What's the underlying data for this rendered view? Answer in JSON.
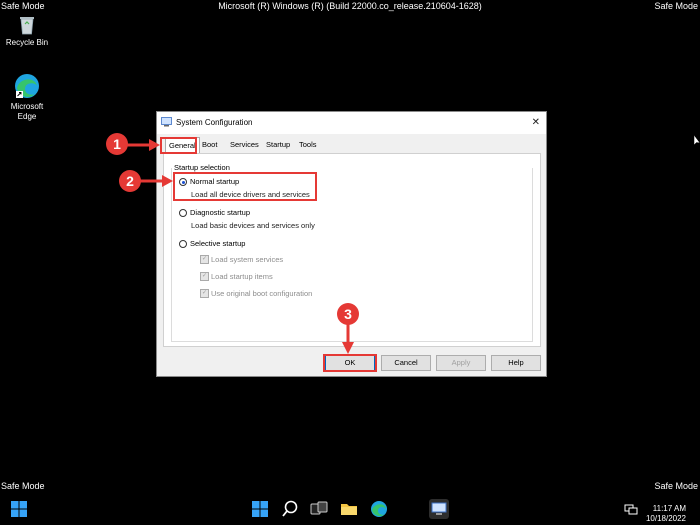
{
  "screen": {
    "top_left": "Safe Mode",
    "top_right": "Safe Mode",
    "bottom_left": "Safe Mode",
    "bottom_right": "Safe Mode",
    "top_center": "Microsoft (R) Windows (R) (Build 22000.co_release.210604-1628)"
  },
  "desktop": {
    "icons": [
      {
        "label": "Recycle Bin",
        "icon": "recycle-bin-icon"
      },
      {
        "label_line1": "Microsoft",
        "label_line2": "Edge",
        "icon": "edge-icon"
      }
    ]
  },
  "dialog": {
    "title": "System Configuration",
    "close_glyph": "✕",
    "tabs": [
      "General",
      "Boot",
      "Services",
      "Startup",
      "Tools"
    ],
    "active_tab": "General",
    "group_title": "Startup selection",
    "options": [
      {
        "label": "Normal startup",
        "desc": "Load all device drivers and services",
        "selected": true
      },
      {
        "label": "Diagnostic startup",
        "desc": "Load basic devices and services only",
        "selected": false
      },
      {
        "label": "Selective startup",
        "selected": false
      }
    ],
    "checkboxes": [
      {
        "label": "Load system services",
        "checked": true,
        "enabled": false
      },
      {
        "label": "Load startup items",
        "checked": true,
        "enabled": false
      },
      {
        "label": "Use original boot configuration",
        "checked": true,
        "enabled": false
      }
    ],
    "buttons": {
      "ok": "OK",
      "cancel": "Cancel",
      "apply": "Apply",
      "help": "Help"
    }
  },
  "annotations": {
    "badges": [
      "1",
      "2",
      "3"
    ],
    "color": "#e53935"
  },
  "taskbar": {
    "apps": [
      "start-icon",
      "search-icon",
      "task-view-icon",
      "file-explorer-icon",
      "edge-icon",
      "system-configuration-icon"
    ],
    "time": "11:17 AM",
    "date": "10/18/2022"
  }
}
